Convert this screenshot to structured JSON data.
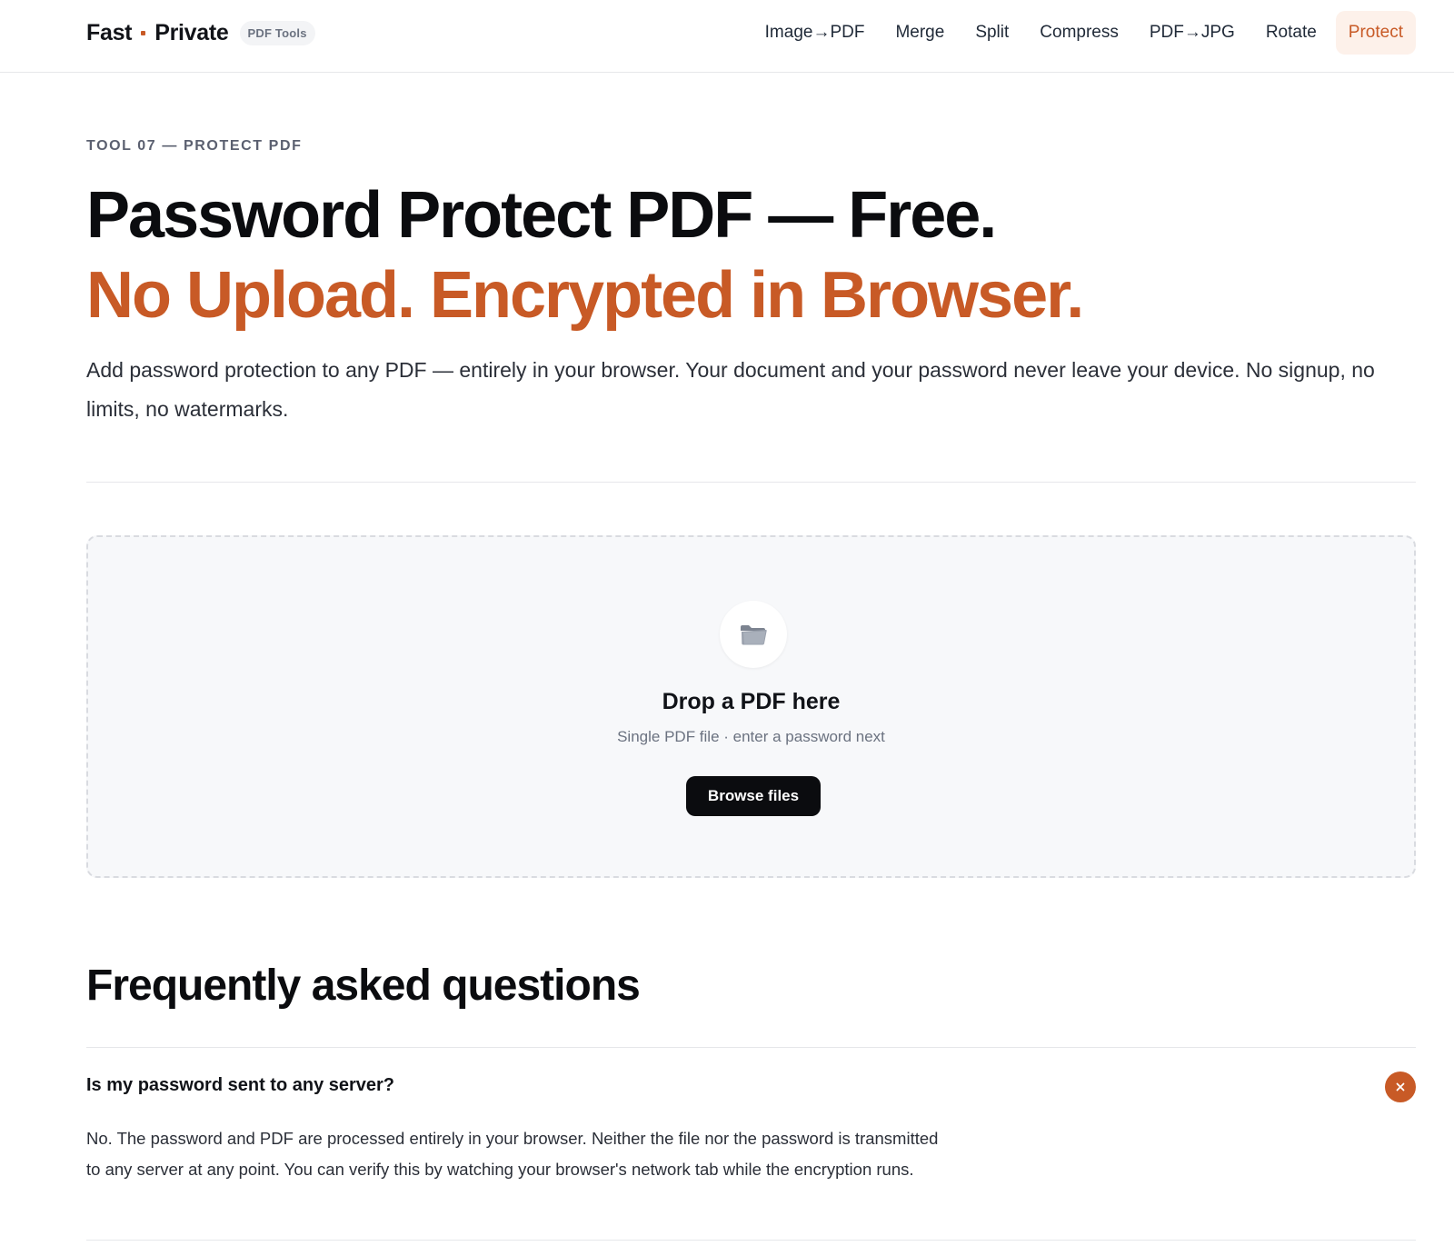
{
  "header": {
    "brand": {
      "part1": "Fast",
      "part2": "Private",
      "badge": "PDF Tools",
      "dot_color": "#c85a26"
    },
    "nav": [
      {
        "label": "Image→PDF",
        "active": false
      },
      {
        "label": "Merge",
        "active": false
      },
      {
        "label": "Split",
        "active": false
      },
      {
        "label": "Compress",
        "active": false
      },
      {
        "label": "PDF→JPG",
        "active": false
      },
      {
        "label": "Rotate",
        "active": false
      },
      {
        "label": "Protect",
        "active": true
      }
    ]
  },
  "hero": {
    "eyebrow": "TOOL 07 — PROTECT PDF",
    "title_line1": "Password Protect PDF — Free.",
    "title_line2": "No Upload. Encrypted in Browser.",
    "lead": "Add password protection to any PDF — entirely in your browser. Your document and your password never leave your device. No signup, no limits, no watermarks."
  },
  "dropzone": {
    "icon": "folder-icon",
    "title": "Drop a PDF here",
    "subtitle": "Single PDF file · enter a password next",
    "button_label": "Browse files"
  },
  "faq": {
    "title": "Frequently asked questions",
    "items": [
      {
        "question": "Is my password sent to any server?",
        "answer": "No. The password and PDF are processed entirely in your browser. Neither the file nor the password is transmitted to any server at any point. You can verify this by watching your browser's network tab while the encryption runs.",
        "expanded": true,
        "toggle_icon": "close-icon"
      }
    ]
  },
  "colors": {
    "accent": "#c85a26",
    "text": "#111318",
    "muted": "#6b7280"
  }
}
